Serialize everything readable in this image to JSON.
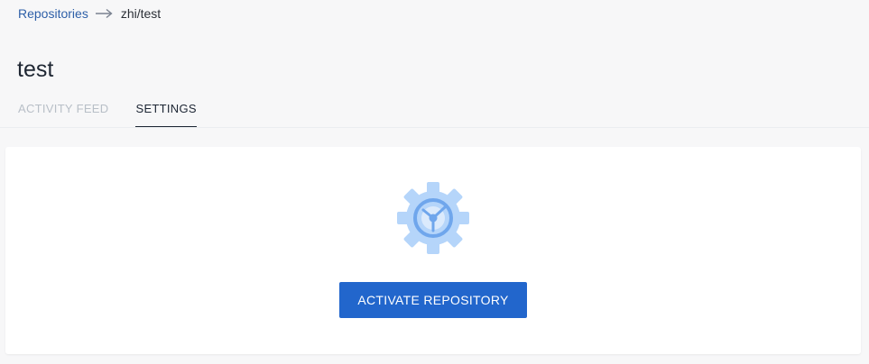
{
  "breadcrumb": {
    "parent_label": "Repositories",
    "current_label": "zhi/test",
    "separator_icon": "arrow-right-icon"
  },
  "page": {
    "title": "test"
  },
  "tabs": [
    {
      "label": "ACTIVITY FEED",
      "active": false
    },
    {
      "label": "SETTINGS",
      "active": true
    }
  ],
  "empty_state": {
    "icon": "gear-icon",
    "button_label": "ACTIVATE REPOSITORY"
  },
  "colors": {
    "accent": "#2266cc",
    "link": "#2d5fa8",
    "background": "#f7f7f8",
    "card": "#ffffff",
    "icon_light": "#b5d5fa",
    "icon_dark": "#6fa6ec"
  }
}
